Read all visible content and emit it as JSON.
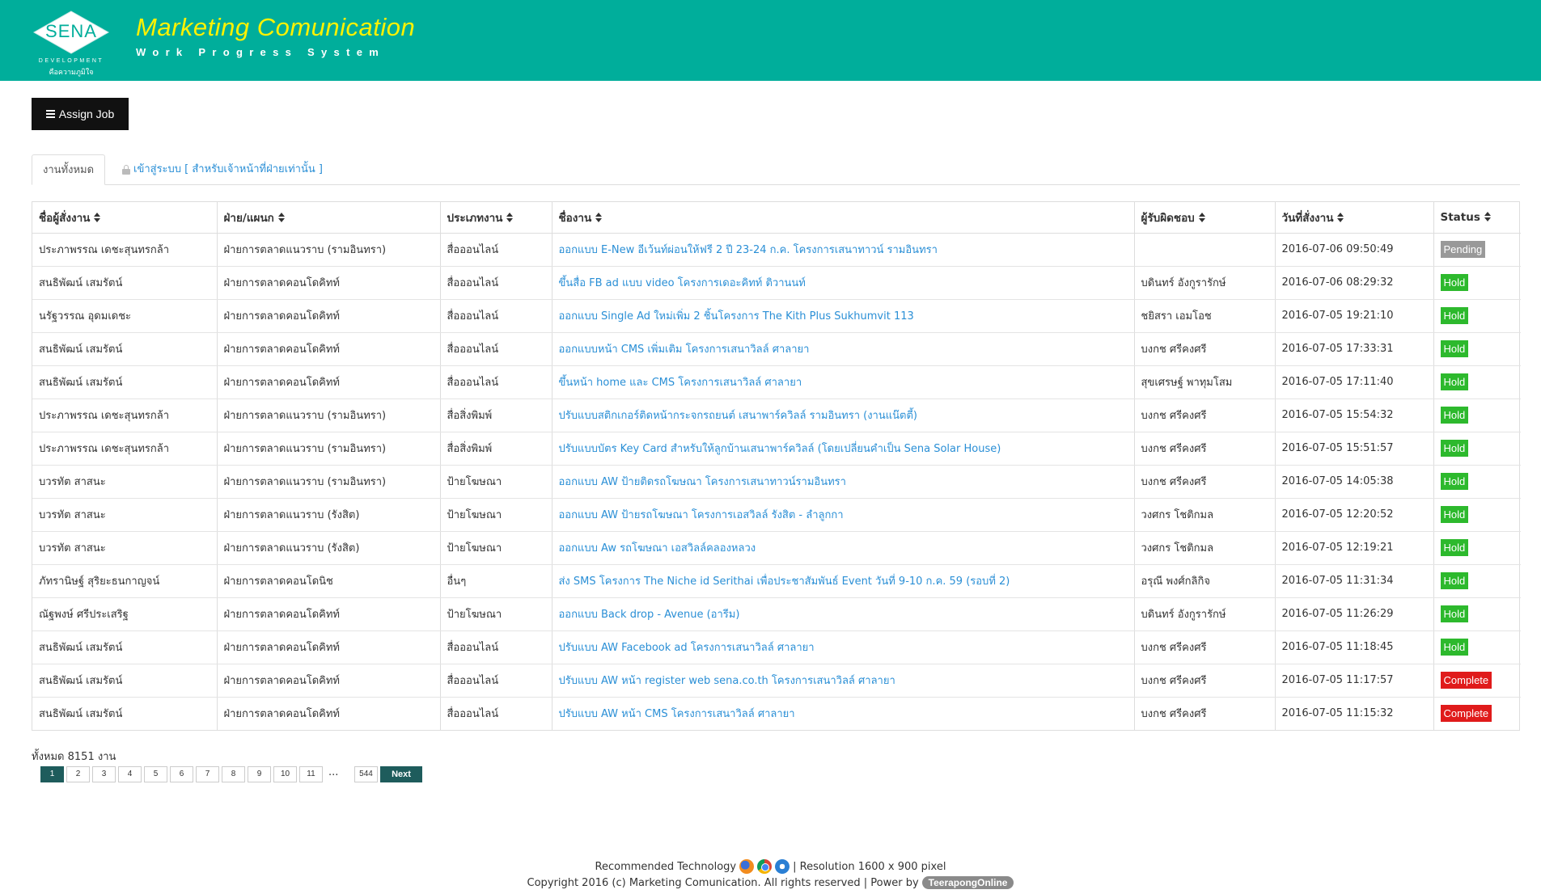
{
  "header": {
    "logo_name": "SENA",
    "logo_sub": "DEVELOPMENT",
    "logo_tagline": "คือความภูมิใจ",
    "title": "Marketing Comunication",
    "subtitle": "Work Progress System",
    "bg_color": "#00ae9b",
    "title_color": "#fff200"
  },
  "toolbar": {
    "assign_label": "Assign Job",
    "assign_icon": "menu-icon"
  },
  "tabs": {
    "all_label": "งานทั้งหมด",
    "login_label": "เข้าสู่ระบบ [ สำหรับเจ้าหน้าที่ฝ่ายเท่านั้น ]",
    "login_icon": "lock-icon"
  },
  "table": {
    "columns": [
      "ชื่อผู้สั่งงาน",
      "ฝ่าย/แผนก",
      "ประเภทงาน",
      "ชื่องาน",
      "ผู้รับผิดชอบ",
      "วันที่สั่งงาน",
      "Status"
    ],
    "rows": [
      {
        "requester": "ประภาพรรณ เดชะสุนทรกล้า",
        "dept": "ฝ่ายการตลาดแนวราบ (รามอินทรา)",
        "type": "สื่อออนไลน์",
        "job": "ออกแบบ E-New อีเว้นท์ผ่อนให้ฟรี 2 ปี 23-24 ก.ค. โครงการเสนาทาวน์ รามอินทรา",
        "owner": "",
        "date": "2016-07-06 09:50:49",
        "status": "Pending"
      },
      {
        "requester": "สนธิพัฒน์ เสมรัตน์",
        "dept": "ฝ่ายการตลาดคอนโดคิทท์",
        "type": "สื่อออนไลน์",
        "job": "ขึ้นสื่อ FB ad แบบ video โครงการเดอะคิทท์ ติวานนท์",
        "owner": "บดินทร์ อังกูรารักษ์",
        "date": "2016-07-06 08:29:32",
        "status": "Hold"
      },
      {
        "requester": "นรัฐวรรณ อุดมเดชะ",
        "dept": "ฝ่ายการตลาดคอนโดคิทท์",
        "type": "สื่อออนไลน์",
        "job": "ออกแบบ Single Ad ใหม่เพิ่ม 2 ชิ้นโครงการ The Kith Plus Sukhumvit 113",
        "owner": "ชยิสรา เอมโอช",
        "date": "2016-07-05 19:21:10",
        "status": "Hold"
      },
      {
        "requester": "สนธิพัฒน์ เสมรัตน์",
        "dept": "ฝ่ายการตลาดคอนโดคิทท์",
        "type": "สื่อออนไลน์",
        "job": "ออกแบบหน้า CMS เพิ่มเติม โครงการเสนาวิลล์ ศาลายา",
        "owner": "บงกช ศรีคงศรี",
        "date": "2016-07-05 17:33:31",
        "status": "Hold"
      },
      {
        "requester": "สนธิพัฒน์ เสมรัตน์",
        "dept": "ฝ่ายการตลาดคอนโดคิทท์",
        "type": "สื่อออนไลน์",
        "job": "ขึ้นหน้า home และ CMS โครงการเสนาวิลล์ ศาลายา",
        "owner": "สุขเศรษฐ์ พาทุมโสม",
        "date": "2016-07-05 17:11:40",
        "status": "Hold"
      },
      {
        "requester": "ประภาพรรณ เดชะสุนทรกล้า",
        "dept": "ฝ่ายการตลาดแนวราบ (รามอินทรา)",
        "type": "สื่อสิ่งพิมพ์",
        "job": "ปรับแบบสติกเกอร์ติดหน้ากระจกรถยนต์ เสนาพาร์ควิลล์ รามอินทรา (งานแน๊ตตี้)",
        "owner": "บงกช ศรีคงศรี",
        "date": "2016-07-05 15:54:32",
        "status": "Hold"
      },
      {
        "requester": "ประภาพรรณ เดชะสุนทรกล้า",
        "dept": "ฝ่ายการตลาดแนวราบ (รามอินทรา)",
        "type": "สื่อสิ่งพิมพ์",
        "job": "ปรับแบบบัตร Key Card สำหรับให้ลูกบ้านเสนาพาร์ควิลล์ (โดยเปลี่ยนคำเป็น Sena Solar House)",
        "owner": "บงกช ศรีคงศรี",
        "date": "2016-07-05 15:51:57",
        "status": "Hold"
      },
      {
        "requester": "บวรทัต สาสนะ",
        "dept": "ฝ่ายการตลาดแนวราบ (รามอินทรา)",
        "type": "ป้ายโฆษณา",
        "job": "ออกแบบ AW ป้ายติดรถโฆษณา โครงการเสนาทาวน์รามอินทรา",
        "owner": "บงกช ศรีคงศรี",
        "date": "2016-07-05 14:05:38",
        "status": "Hold"
      },
      {
        "requester": "บวรทัต สาสนะ",
        "dept": "ฝ่ายการตลาดแนวราบ (รังสิต)",
        "type": "ป้ายโฆษณา",
        "job": "ออกแบบ AW ป้ายรถโฆษณา โครงการเอสวิลล์ รังสิต - ลำลูกกา",
        "owner": "วงศกร โชติกมล",
        "date": "2016-07-05 12:20:52",
        "status": "Hold"
      },
      {
        "requester": "บวรทัต สาสนะ",
        "dept": "ฝ่ายการตลาดแนวราบ (รังสิต)",
        "type": "ป้ายโฆษณา",
        "job": "ออกแบบ Aw รถโฆษณา เอสวิลล์คลองหลวง",
        "owner": "วงศกร โชติกมล",
        "date": "2016-07-05 12:19:21",
        "status": "Hold"
      },
      {
        "requester": "ภัทรานิษฐ์ สุริยะธนกาญจน์",
        "dept": "ฝ่ายการตลาดคอนโดนิช",
        "type": "อื่นๆ",
        "job": "ส่ง SMS โครงการ The Niche id Serithai เพื่อประชาสัมพันธ์ Event วันที่ 9-10 ก.ค. 59 (รอบที่ 2)",
        "owner": "อรุณี พงศ์กลิกิจ",
        "date": "2016-07-05 11:31:34",
        "status": "Hold"
      },
      {
        "requester": "ณัฐพงษ์ ศรีประเสริฐ",
        "dept": "ฝ่ายการตลาดคอนโดคิทท์",
        "type": "ป้ายโฆษณา",
        "job": "ออกแบบ Back drop - Avenue (อารีม)",
        "owner": "บดินทร์ อังกูรารักษ์",
        "date": "2016-07-05 11:26:29",
        "status": "Hold"
      },
      {
        "requester": "สนธิพัฒน์ เสมรัตน์",
        "dept": "ฝ่ายการตลาดคอนโดคิทท์",
        "type": "สื่อออนไลน์",
        "job": "ปรับแบบ AW Facebook ad โครงการเสนาวิลล์ ศาลายา",
        "owner": "บงกช ศรีคงศรี",
        "date": "2016-07-05 11:18:45",
        "status": "Hold"
      },
      {
        "requester": "สนธิพัฒน์ เสมรัตน์",
        "dept": "ฝ่ายการตลาดคอนโดคิทท์",
        "type": "สื่อออนไลน์",
        "job": "ปรับแบบ AW หน้า register web sena.co.th โครงการเสนาวิลล์ ศาลายา",
        "owner": "บงกช ศรีคงศรี",
        "date": "2016-07-05 11:17:57",
        "status": "Complete"
      },
      {
        "requester": "สนธิพัฒน์ เสมรัตน์",
        "dept": "ฝ่ายการตลาดคอนโดคิทท์",
        "type": "สื่อออนไลน์",
        "job": "ปรับแบบ AW หน้า CMS โครงการเสนาวิลล์ ศาลายา",
        "owner": "บงกช ศรีคงศรี",
        "date": "2016-07-05 11:15:32",
        "status": "Complete"
      }
    ],
    "status_colors": {
      "Pending": "#999999",
      "Hold": "#2db92d",
      "Complete": "#e01b1b"
    }
  },
  "pagination": {
    "total_label": "ทั้งหมด 8151 งาน",
    "pages": [
      "1",
      "2",
      "3",
      "4",
      "5",
      "6",
      "7",
      "8",
      "9",
      "10",
      "11"
    ],
    "ellipsis": "...",
    "last_page": "544",
    "next_label": "Next",
    "current": "1"
  },
  "footer": {
    "recommended": "Recommended Technology",
    "browsers": [
      "firefox-icon",
      "chrome-icon",
      "ie-icon"
    ],
    "resolution": "| Resolution 1600 x 900 pixel",
    "copyright": "Copyright 2016 (c) Marketing Comunication. All rights reserved | Power by",
    "power_by": "TeerapongOnline"
  }
}
